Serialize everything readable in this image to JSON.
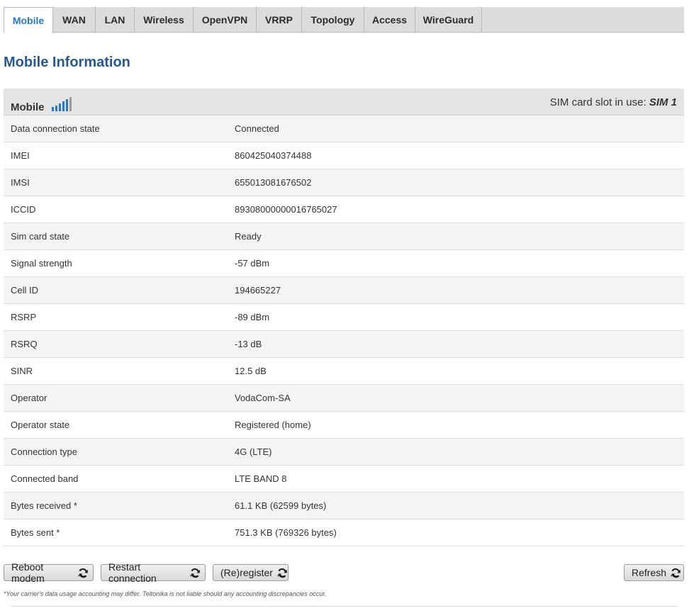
{
  "tabs": [
    {
      "label": "Mobile",
      "active": true
    },
    {
      "label": "WAN"
    },
    {
      "label": "LAN"
    },
    {
      "label": "Wireless"
    },
    {
      "label": "OpenVPN"
    },
    {
      "label": "VRRP"
    },
    {
      "label": "Topology"
    },
    {
      "label": "Access"
    },
    {
      "label": "WireGuard"
    }
  ],
  "page_title": "Mobile Information",
  "table": {
    "header_label": "Mobile",
    "signal_icon": "signal-bars-icon",
    "sim_slot_label": "SIM card slot in use:",
    "sim_slot_value": "SIM 1",
    "rows": [
      {
        "key": "Data connection state",
        "value": "Connected"
      },
      {
        "key": "IMEI",
        "value": "860425040374488"
      },
      {
        "key": "IMSI",
        "value": "655013081676502"
      },
      {
        "key": "ICCID",
        "value": "89308000000016765027"
      },
      {
        "key": "Sim card state",
        "value": "Ready"
      },
      {
        "key": "Signal strength",
        "value": "-57 dBm"
      },
      {
        "key": "Cell ID",
        "value": "194665227"
      },
      {
        "key": "RSRP",
        "value": "-89 dBm"
      },
      {
        "key": "RSRQ",
        "value": "-13 dB"
      },
      {
        "key": "SINR",
        "value": "12.5 dB"
      },
      {
        "key": "Operator",
        "value": "VodaCom-SA"
      },
      {
        "key": "Operator state",
        "value": "Registered (home)"
      },
      {
        "key": "Connection type",
        "value": "4G (LTE)"
      },
      {
        "key": "Connected band",
        "value": "LTE BAND 8"
      },
      {
        "key": "Bytes received *",
        "value": "61.1 KB (62599 bytes)"
      },
      {
        "key": "Bytes sent *",
        "value": "751.3 KB (769326 bytes)"
      }
    ]
  },
  "buttons": {
    "reboot_modem": "Reboot modem",
    "restart_connection": "Restart connection",
    "reregister": "(Re)register",
    "refresh": "Refresh"
  },
  "footnote": "*Your carrier's data usage accounting may differ. Teltonika is not liable should any accounting discrepancies occur.",
  "colors": {
    "accent": "#2a78c2",
    "title": "#27588f"
  }
}
